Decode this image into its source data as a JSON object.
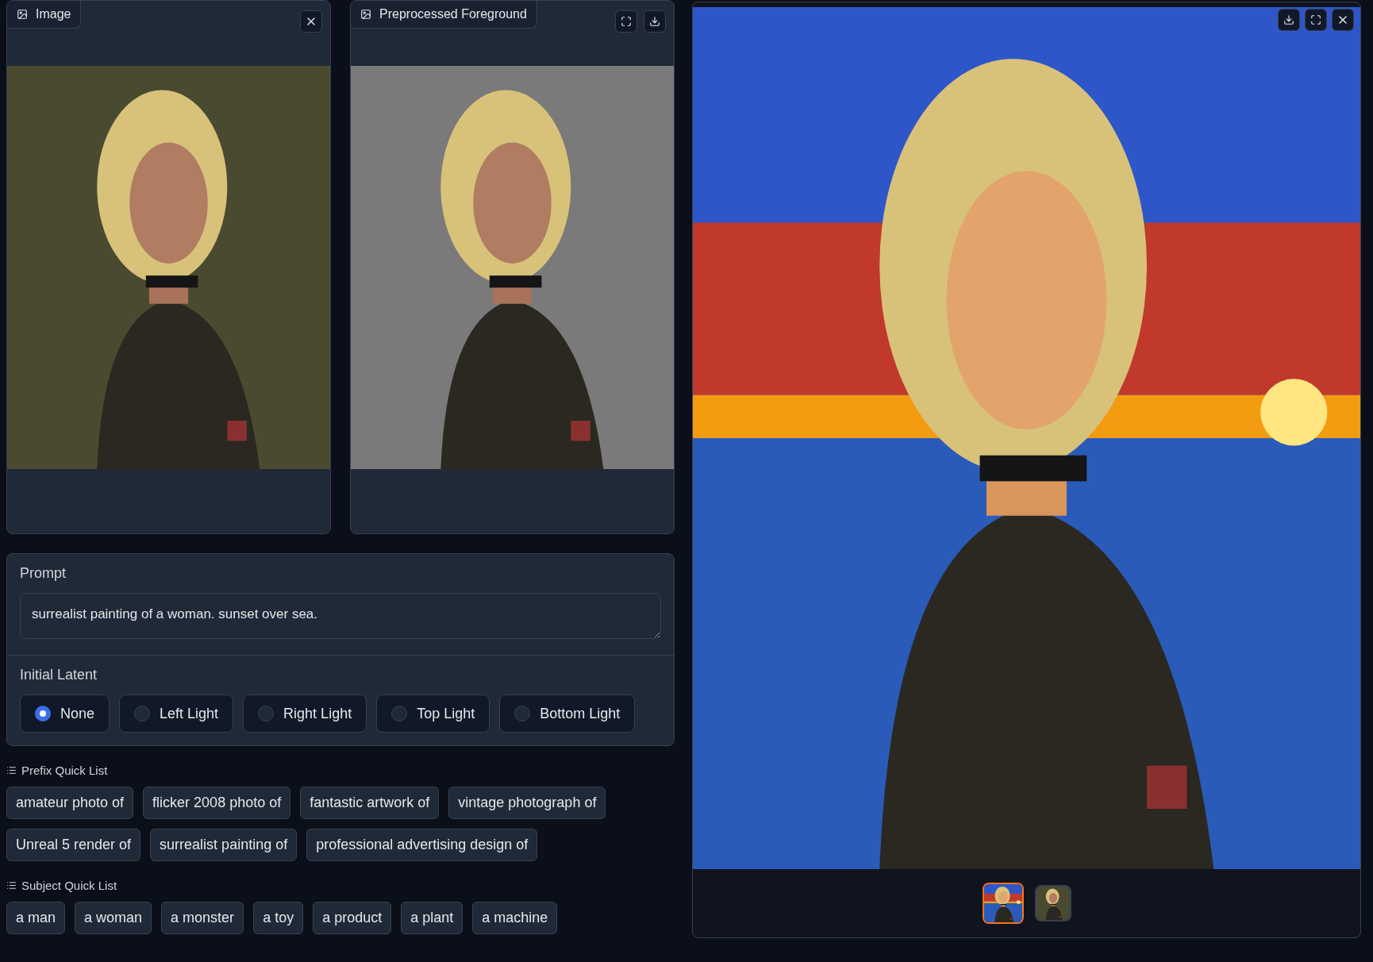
{
  "image_panels": [
    {
      "label": "Image",
      "kind": "input"
    },
    {
      "label": "Preprocessed Foreground",
      "kind": "output"
    }
  ],
  "prompt": {
    "label": "Prompt",
    "value": "surrealist painting of a woman. sunset over sea."
  },
  "initial_latent": {
    "label": "Initial Latent",
    "options": [
      {
        "label": "None",
        "selected": true
      },
      {
        "label": "Left Light",
        "selected": false
      },
      {
        "label": "Right Light",
        "selected": false
      },
      {
        "label": "Top Light",
        "selected": false
      },
      {
        "label": "Bottom Light",
        "selected": false
      }
    ]
  },
  "quick_lists": [
    {
      "title": "Prefix Quick List",
      "items": [
        "amateur photo of",
        "flicker 2008 photo of",
        "fantastic artwork of",
        "vintage photograph of",
        "Unreal 5 render of",
        "surrealist painting of",
        "professional advertising design of"
      ]
    },
    {
      "title": "Subject Quick List",
      "items": [
        "a man",
        "a woman",
        "a monster",
        "a toy",
        "a product",
        "a plant",
        "a machine"
      ]
    }
  ],
  "gallery": {
    "thumbnails": [
      {
        "selected": true,
        "kind": "sunset"
      },
      {
        "selected": false,
        "kind": "dark"
      }
    ]
  }
}
